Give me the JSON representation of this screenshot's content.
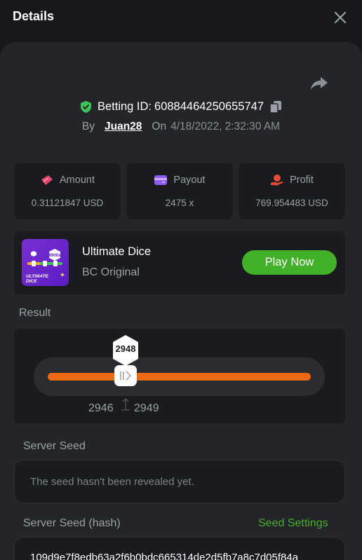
{
  "header": {
    "title": "Details"
  },
  "bet": {
    "id_label": "Betting ID:",
    "id_value": "60884464250655747",
    "by_label": "By",
    "username": "Juan28",
    "on_label": "On",
    "date": "4/18/2022, 2:32:30 AM"
  },
  "stats": {
    "amount": {
      "label": "Amount",
      "value": "0.31121847 USD",
      "icon": "coins-icon",
      "color": "#e8456b"
    },
    "payout": {
      "label": "Payout",
      "value": "2475 x",
      "icon": "wallet-icon",
      "color": "#8e5bf2"
    },
    "profit": {
      "label": "Profit",
      "value": "769.954483 USD",
      "icon": "hand-money-icon",
      "color": "#e84a3a"
    }
  },
  "game": {
    "name": "Ultimate Dice",
    "subtitle": "BC Original",
    "play_label": "Play Now",
    "thumb_text": "ULTIMATE DICE",
    "thumb_badge": "9900x"
  },
  "result": {
    "label": "Result",
    "value": "2948",
    "range_low": "2946",
    "range_high": "2949",
    "track_color": "#eb6a13"
  },
  "server_seed": {
    "label": "Server Seed",
    "placeholder": "The seed hasn't been revealed yet."
  },
  "server_seed_hash": {
    "label": "Server Seed (hash)",
    "settings_label": "Seed Settings",
    "value": "109d9e7f8edb63a2f6b0bdc665314de2d5fb7a8c7d05f84a"
  },
  "colors": {
    "accent": "#43b02a",
    "background": "#17181b",
    "panel": "#232528"
  }
}
